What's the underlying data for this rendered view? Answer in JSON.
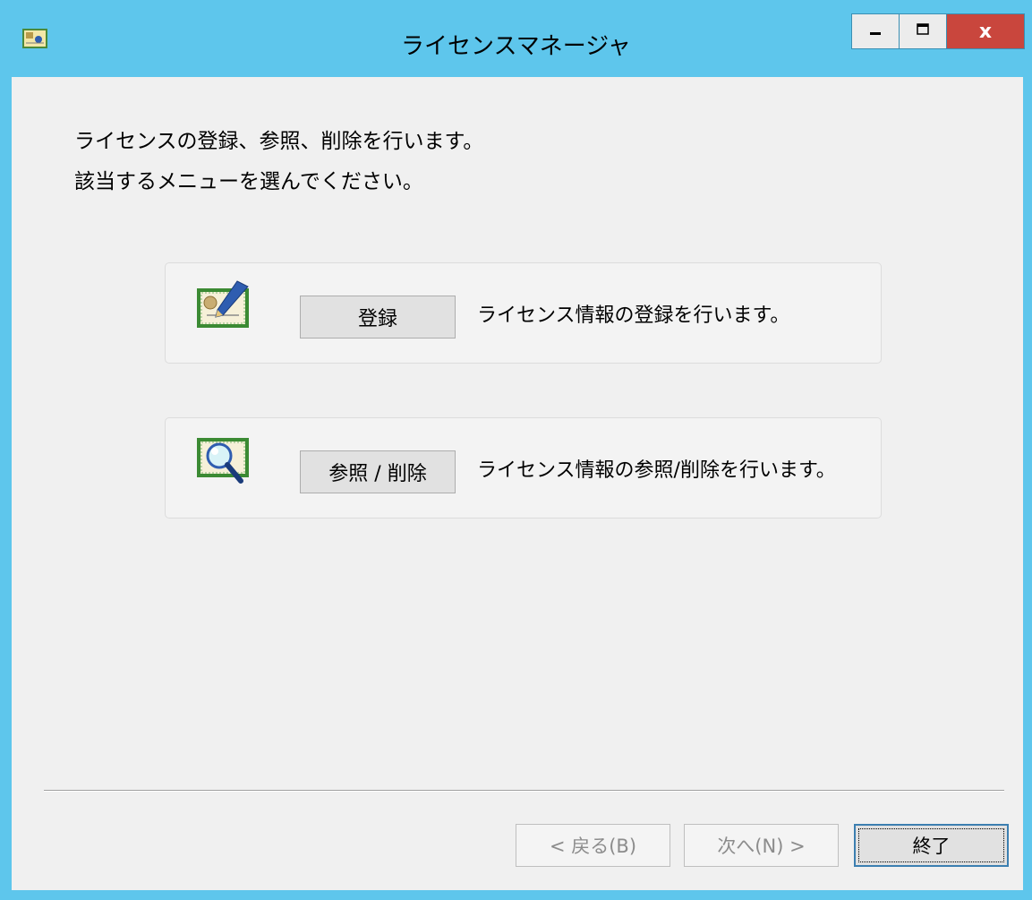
{
  "window": {
    "title": "ライセンスマネージャ",
    "icons": {
      "app": "license-manager-icon",
      "minimize": "minimize-icon",
      "maximize": "maximize-icon",
      "close": "close-icon"
    },
    "close_symbol": "x",
    "colors": {
      "frame": "#5ec6ec",
      "close_button": "#c9463d",
      "client_background": "#f0f0f0"
    }
  },
  "intro": {
    "line1": "ライセンスの登録、参照、削除を行います。",
    "line2": "該当するメニューを選んでください。"
  },
  "options": [
    {
      "icon": "certificate-edit-icon",
      "button_label": "登録",
      "description": "ライセンス情報の登録を行います。"
    },
    {
      "icon": "certificate-search-icon",
      "button_label": "参照 / 削除",
      "description": "ライセンス情報の参照/削除を行います。"
    }
  ],
  "footer": {
    "back_label": "< 戻る(B)",
    "next_label": "次へ(N) >",
    "finish_label": "終了"
  }
}
